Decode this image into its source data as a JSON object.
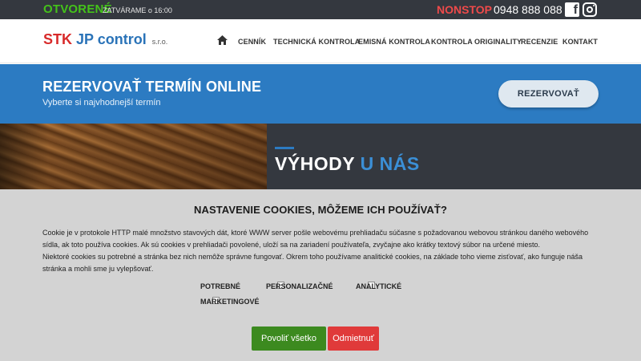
{
  "topbar": {
    "open_label": "OTVORENÉ",
    "closing_text": "ZATVÁRAME o 16:00",
    "nonstop_label": "NONSTOP",
    "phone": "0948 888 088",
    "social_icons": [
      "facebook-icon",
      "instagram-icon"
    ]
  },
  "header": {
    "logo": {
      "part1": "STK",
      "part2": "JP control",
      "suffix": "s.r.o."
    },
    "nav": [
      {
        "icon": "home-icon"
      },
      {
        "label": "CENNÍK"
      },
      {
        "label": "TECHNICKÁ KONTROLA"
      },
      {
        "label": "EMISNÁ KONTROLA"
      },
      {
        "label": "KONTROLA ORIGINALITY"
      },
      {
        "label": "RECENZIE"
      },
      {
        "label": "KONTAKT"
      }
    ]
  },
  "reservation": {
    "title": "REZERVOVAŤ TERMÍN ONLINE",
    "subtitle": "Vyberte si najvhodnejší termín",
    "button_label": "REZERVOVAŤ"
  },
  "benefits": {
    "title_part1": "VÝHODY",
    "title_part2": "U NÁS"
  },
  "cookies": {
    "title": "NASTAVENIE COOKIES, MÔŽEME ICH POUŽÍVAŤ?",
    "paragraph1_line1": "Cookie je v protokole HTTP malé množstvo stavových dát, ktoré WWW server pošle webovému prehliadaču súčasne s požadovanou webovou stránkou daného webového",
    "paragraph1_line2": "sídla, ak toto používa cookies. Ak sú cookies v prehliadači povolené, uloží sa na zariadení používateľa, zvyčajne ako krátky textový súbor na určené miesto.",
    "paragraph2_line1": "Niektoré cookies su potrebné a stránka bez nich nemôže správne fungovať. Okrem toho používame analitické cookies, na základe toho vieme zisťovať, ako funguje náša",
    "paragraph2_line2": "stránka a mohli sme ju vylepšovať.",
    "options": [
      {
        "label": "POTREBNÉ",
        "has_checkbox": false
      },
      {
        "label": "PERSONALIZAČNÉ",
        "checked": false
      },
      {
        "label": "ANALYTICKÉ",
        "checked": false
      },
      {
        "label": "MARKETINGOVÉ",
        "checked": false
      }
    ],
    "accept_all_label": "Povoliť všetko",
    "reject_label": "Odmietnuť",
    "colors": {
      "accept": "#3c8a1f",
      "reject": "#e03a3a"
    }
  },
  "colors": {
    "topbar_bg": "#34383f",
    "open_green": "#44c21a",
    "nonstop_red": "#ef4a4a",
    "brand_blue": "#2c7bc2",
    "brand_red": "#d82a2a"
  }
}
